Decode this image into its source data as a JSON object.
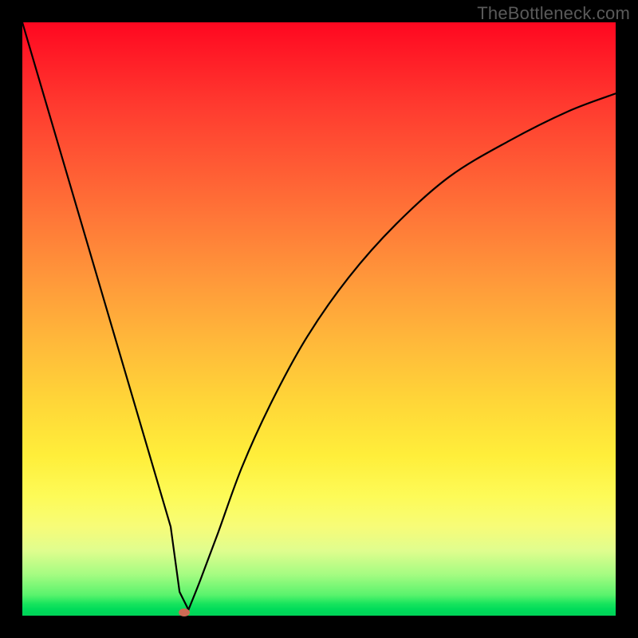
{
  "watermark": "TheBottleneck.com",
  "accent_dot_color": "#cd6a54",
  "gradient": {
    "top": "#ff0720",
    "bottom": "#00d257"
  },
  "chart_data": {
    "type": "line",
    "title": "",
    "xlabel": "",
    "ylabel": "",
    "xlim": [
      0,
      100
    ],
    "ylim": [
      0,
      100
    ],
    "grid": false,
    "legend": false,
    "series": [
      {
        "name": "curve",
        "x": [
          0,
          5,
          10,
          15,
          20,
          25,
          26.5,
          28,
          30,
          33,
          37,
          42,
          48,
          55,
          63,
          72,
          82,
          92,
          100
        ],
        "values": [
          100,
          83,
          66,
          49,
          32,
          15,
          4,
          1,
          6,
          14,
          25,
          36,
          47,
          57,
          66,
          74,
          80,
          85,
          88
        ]
      }
    ],
    "minimum_point": {
      "x": 27.3,
      "y": 0.5
    },
    "explanation": "Single black V-shaped curve on a red-to-green vertical gradient background; steep linear descent from top-left to a sharp minimum near x≈27, then a decelerating rise toward the upper right. Small reddish oval marker at the minimum."
  }
}
